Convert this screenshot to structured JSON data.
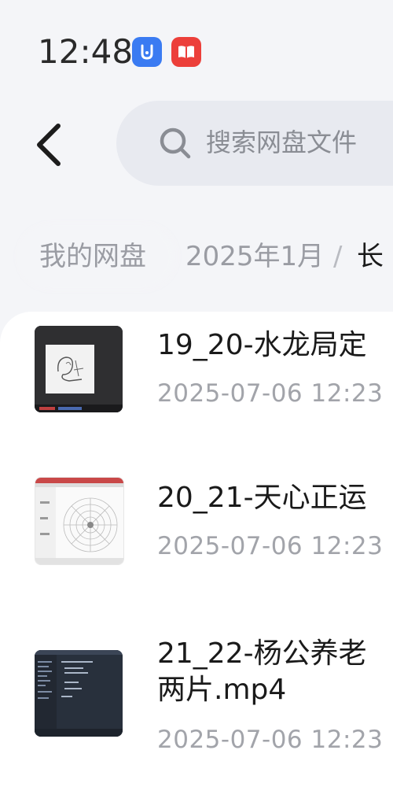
{
  "status_bar": {
    "time": "12:48",
    "apps": [
      "alarm-app-icon",
      "book-app-icon"
    ]
  },
  "header": {
    "back_icon": "chevron-left-icon",
    "search": {
      "icon": "search-icon",
      "placeholder": "搜索网盘文件"
    }
  },
  "breadcrumb": {
    "items": [
      "我的网盘",
      "2025年1月",
      "长"
    ],
    "separator": "/"
  },
  "files": [
    {
      "name": "19_20-水龙局定",
      "date": "2025-07-06  12:23",
      "thumbnail": "dark-frame-sketch-thumbnail"
    },
    {
      "name": "20_21-天心正运",
      "date": "2025-07-06  12:23",
      "thumbnail": "compass-diagram-thumbnail"
    },
    {
      "name_line1": "21_22-杨公养老",
      "name_line2": "两片.mp4",
      "date": "2025-07-06  12:23",
      "thumbnail": "code-editor-thumbnail"
    }
  ],
  "colors": {
    "background": "#f4f5f8",
    "search_bg": "#e8eaf0",
    "title_text": "#1a1a1a",
    "secondary_text": "#a2a4aa",
    "status_blue": "#3a7bf2",
    "status_red": "#ec3f3a"
  }
}
